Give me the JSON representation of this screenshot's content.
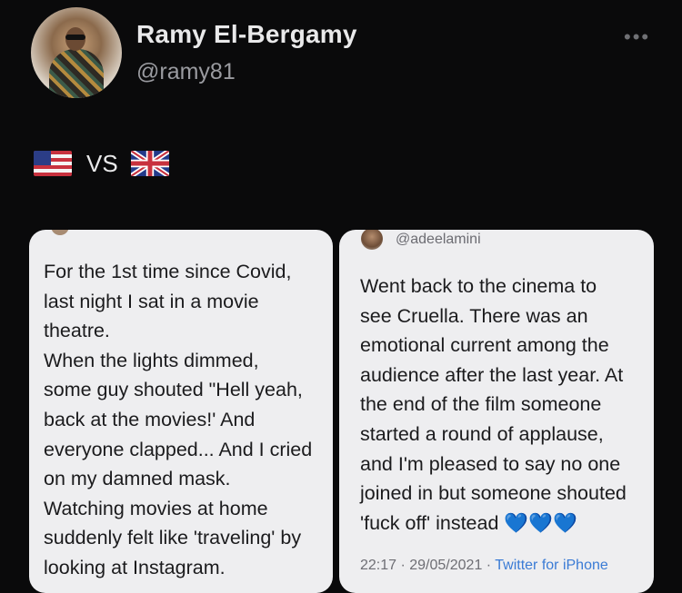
{
  "profile": {
    "display_name": "Ramy El-Bergamy",
    "handle": "@ramy81",
    "more_icon": "more-dots-icon"
  },
  "tweet": {
    "vs_text": "VS",
    "flag_left": "us-flag-icon",
    "flag_right": "uk-flag-icon"
  },
  "left_card": {
    "header_handle": "",
    "text": "For the 1st time since Covid,\nlast night I sat in a movie\ntheatre.\nWhen the lights dimmed,\nsome guy shouted \"Hell yeah,\nback at the movies!' And\neveryone clapped... And I cried\non my damned mask.\nWatching movies at home\nsuddenly felt like 'traveling' by\nlooking at Instagram."
  },
  "right_card": {
    "header_handle": "@adeelamini",
    "text": "Went back to the cinema to\nsee Cruella. There was an\nemotional current among the\naudience after the last year. At\nthe end of the film someone\nstarted a round of applause,\nand I'm pleased to say no one\njoined in but someone shouted\n'fuck off' instead ",
    "hearts": "💙💙💙",
    "timestamp": "22:17 · 29/05/2021 · ",
    "source": "Twitter for iPhone"
  },
  "colors": {
    "background": "#0a0a0b",
    "card": "#eeeef0",
    "accent": "#3a7bd5",
    "heart": "#3b82f6"
  }
}
